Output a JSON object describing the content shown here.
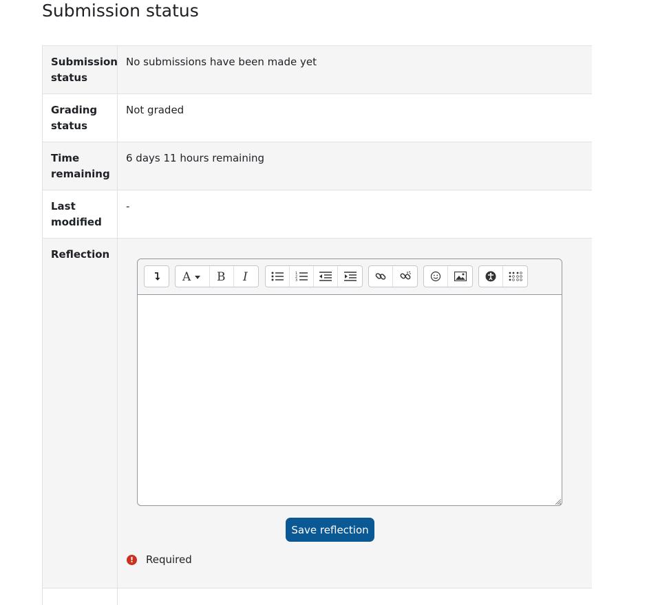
{
  "page_title": "Submission status",
  "rows": [
    {
      "label": "Submission status",
      "value": "No submissions have been made yet"
    },
    {
      "label": "Grading status",
      "value": "Not graded"
    },
    {
      "label": "Time remaining",
      "value": "6 days 11 hours remaining"
    },
    {
      "label": "Last modified",
      "value": "-"
    },
    {
      "label": "Reflection",
      "value": ""
    }
  ],
  "editor": {
    "toolbar_icons": [
      "collapse-icon",
      "font-style-icon",
      "bold-icon",
      "italic-icon",
      "unordered-list-icon",
      "ordered-list-icon",
      "outdent-icon",
      "indent-icon",
      "link-icon",
      "unlink-icon",
      "emoji-icon",
      "image-icon",
      "accessibility-checker-icon",
      "screen-reader-helper-icon"
    ],
    "content": ""
  },
  "save_button": "Save reflection",
  "required_text": "Required",
  "colors": {
    "primary_button": "#0a5894",
    "required_icon": "#ca3120",
    "row_alt": "#f5f5f5",
    "border": "#dee2e6"
  }
}
